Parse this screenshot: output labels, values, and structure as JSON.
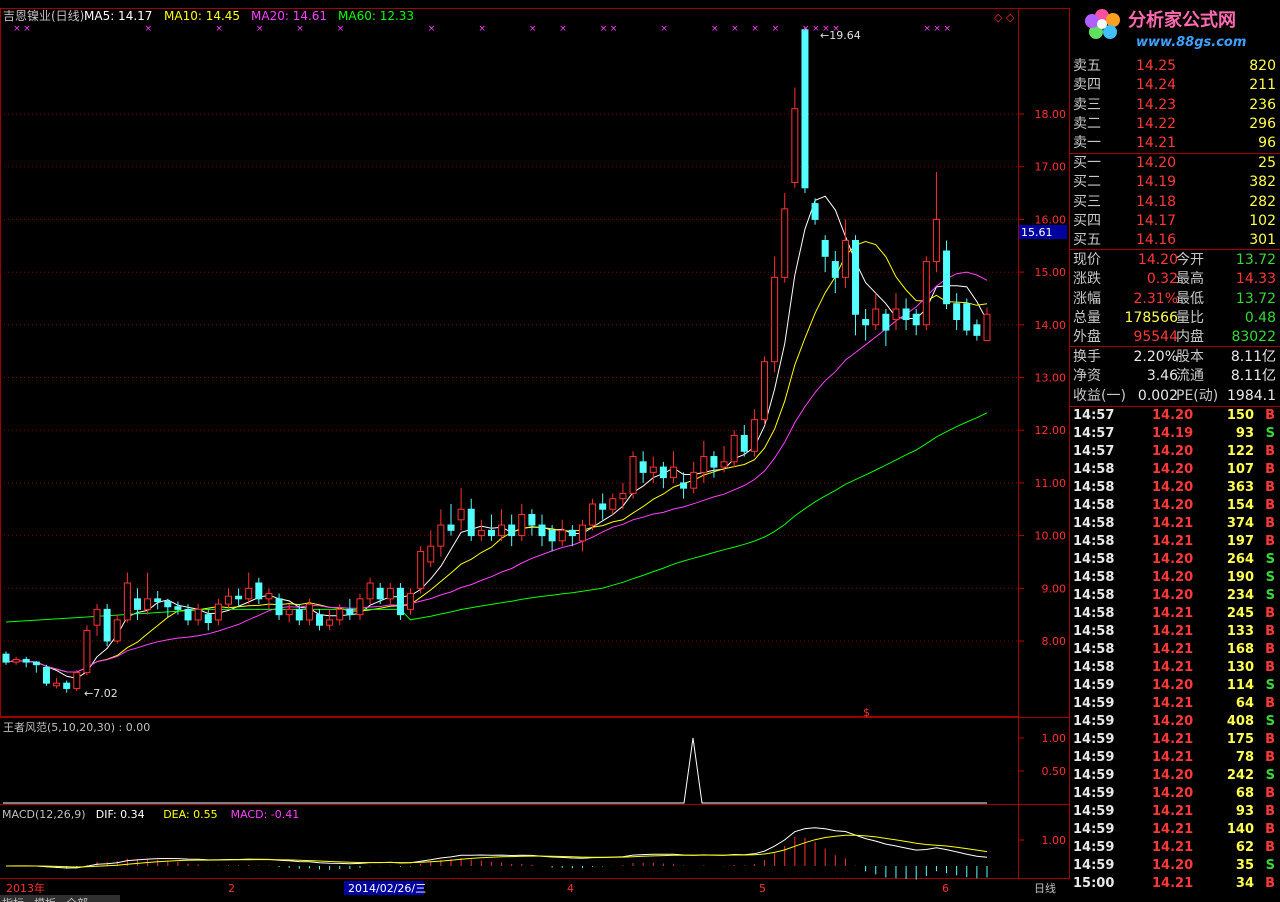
{
  "main_panel": {
    "title": "吉恩镍业(日线)",
    "ma_labels": [
      {
        "text": "MA5: 14.17",
        "color": "#ffffff"
      },
      {
        "text": "MA10: 14.45",
        "color": "#ffff00"
      },
      {
        "text": "MA20: 14.61",
        "color": "#ff40ff"
      },
      {
        "text": "MA60: 12.33",
        "color": "#00ff00"
      }
    ],
    "high_mark": "19.64",
    "low_mark": "7.02",
    "current_price_tag": "15.61",
    "y_ticks": [
      "18.00",
      "17.00",
      "16.00",
      "15.00",
      "14.00",
      "13.00",
      "12.00",
      "11.00",
      "10.00",
      "9.00",
      "8.00"
    ],
    "signal_marker": "$",
    "x_labels": [
      "2013年",
      "2",
      "2014/02/26/三",
      "4",
      "5",
      "6",
      "日线"
    ]
  },
  "indicator_panel": {
    "title": "王者风范(5,10,20,30) : 0.00",
    "y_ticks": [
      "1.00",
      "0.50"
    ]
  },
  "macd_panel": {
    "labels": [
      {
        "text": "MACD(12,26,9)",
        "color": "#c0c0c0"
      },
      {
        "text": "DIF: 0.34",
        "color": "#ffffff"
      },
      {
        "text": "DEA: 0.55",
        "color": "#ffff00"
      },
      {
        "text": "MACD: -0.41",
        "color": "#ff40ff"
      }
    ],
    "y_ticks": [
      "1.00"
    ]
  },
  "bottom_tabs": [
    "指标",
    "模板",
    "全部"
  ],
  "colors": {
    "up": "#ff3030",
    "down": "#54ffff",
    "grid": "#800000",
    "axis": "#c00000"
  },
  "logo": {
    "text": "分析家公式网",
    "url": "www.88gs.com"
  },
  "order_book": {
    "sell": [
      {
        "label": "卖五",
        "price": "14.25",
        "vol": "820"
      },
      {
        "label": "卖四",
        "price": "14.24",
        "vol": "211"
      },
      {
        "label": "卖三",
        "price": "14.23",
        "vol": "236"
      },
      {
        "label": "卖二",
        "price": "14.22",
        "vol": "296"
      },
      {
        "label": "卖一",
        "price": "14.21",
        "vol": "96"
      }
    ],
    "buy": [
      {
        "label": "买一",
        "price": "14.20",
        "vol": "25"
      },
      {
        "label": "买二",
        "price": "14.19",
        "vol": "382"
      },
      {
        "label": "买三",
        "price": "14.18",
        "vol": "282"
      },
      {
        "label": "买四",
        "price": "14.17",
        "vol": "102"
      },
      {
        "label": "买五",
        "price": "14.16",
        "vol": "301"
      }
    ]
  },
  "quote": [
    {
      "l1": "现价",
      "v1": "14.20",
      "c1": "red",
      "l2": "今开",
      "v2": "13.72",
      "c2": "grn"
    },
    {
      "l1": "涨跌",
      "v1": "0.32",
      "c1": "red",
      "l2": "最高",
      "v2": "14.33",
      "c2": "red"
    },
    {
      "l1": "涨幅",
      "v1": "2.31%",
      "c1": "red",
      "l2": "最低",
      "v2": "13.72",
      "c2": "grn"
    },
    {
      "l1": "总量",
      "v1": "178566",
      "c1": "yel",
      "l2": "量比",
      "v2": "0.48",
      "c2": "grn"
    },
    {
      "l1": "外盘",
      "v1": "95544",
      "c1": "red",
      "l2": "内盘",
      "v2": "83022",
      "c2": "grn"
    }
  ],
  "fundamentals": [
    {
      "l1": "换手",
      "v1": "2.20%",
      "l2": "股本",
      "v2": "8.11亿"
    },
    {
      "l1": "净资",
      "v1": "3.46",
      "l2": "流通",
      "v2": "8.11亿"
    },
    {
      "l1": "收益(一)",
      "v1": "0.002",
      "l2": "PE(动)",
      "v2": "1984.1"
    }
  ],
  "ticks": [
    {
      "t": "14:57",
      "p": "14.20",
      "v": "150",
      "s": "B"
    },
    {
      "t": "14:57",
      "p": "14.19",
      "v": "93",
      "s": "S"
    },
    {
      "t": "14:57",
      "p": "14.20",
      "v": "122",
      "s": "B"
    },
    {
      "t": "14:58",
      "p": "14.20",
      "v": "107",
      "s": "B"
    },
    {
      "t": "14:58",
      "p": "14.20",
      "v": "363",
      "s": "B"
    },
    {
      "t": "14:58",
      "p": "14.20",
      "v": "154",
      "s": "B"
    },
    {
      "t": "14:58",
      "p": "14.21",
      "v": "374",
      "s": "B"
    },
    {
      "t": "14:58",
      "p": "14.21",
      "v": "197",
      "s": "B"
    },
    {
      "t": "14:58",
      "p": "14.20",
      "v": "264",
      "s": "S"
    },
    {
      "t": "14:58",
      "p": "14.20",
      "v": "190",
      "s": "S"
    },
    {
      "t": "14:58",
      "p": "14.20",
      "v": "234",
      "s": "S"
    },
    {
      "t": "14:58",
      "p": "14.21",
      "v": "245",
      "s": "B"
    },
    {
      "t": "14:58",
      "p": "14.21",
      "v": "133",
      "s": "B"
    },
    {
      "t": "14:58",
      "p": "14.21",
      "v": "168",
      "s": "B"
    },
    {
      "t": "14:58",
      "p": "14.21",
      "v": "130",
      "s": "B"
    },
    {
      "t": "14:59",
      "p": "14.20",
      "v": "114",
      "s": "S"
    },
    {
      "t": "14:59",
      "p": "14.21",
      "v": "64",
      "s": "B"
    },
    {
      "t": "14:59",
      "p": "14.20",
      "v": "408",
      "s": "S"
    },
    {
      "t": "14:59",
      "p": "14.21",
      "v": "175",
      "s": "B"
    },
    {
      "t": "14:59",
      "p": "14.21",
      "v": "78",
      "s": "B"
    },
    {
      "t": "14:59",
      "p": "14.20",
      "v": "242",
      "s": "S"
    },
    {
      "t": "14:59",
      "p": "14.20",
      "v": "68",
      "s": "B"
    },
    {
      "t": "14:59",
      "p": "14.21",
      "v": "93",
      "s": "B"
    },
    {
      "t": "14:59",
      "p": "14.21",
      "v": "140",
      "s": "B"
    },
    {
      "t": "14:59",
      "p": "14.21",
      "v": "62",
      "s": "B"
    },
    {
      "t": "14:59",
      "p": "14.20",
      "v": "35",
      "s": "S"
    },
    {
      "t": "15:00",
      "p": "14.21",
      "v": "34",
      "s": "B"
    }
  ],
  "chart_data": {
    "type": "candlestick",
    "series": [
      {
        "name": "MA5",
        "last": 14.17
      },
      {
        "name": "MA10",
        "last": 14.45
      },
      {
        "name": "MA20",
        "last": 14.61
      },
      {
        "name": "MA60",
        "last": 12.33
      }
    ],
    "high": 19.64,
    "low": 7.02,
    "candles": [
      [
        7.75,
        7.6,
        7.8,
        7.55
      ],
      [
        7.6,
        7.65,
        7.7,
        7.55
      ],
      [
        7.65,
        7.6,
        7.7,
        7.5
      ],
      [
        7.6,
        7.55,
        7.62,
        7.4
      ],
      [
        7.5,
        7.2,
        7.55,
        7.15
      ],
      [
        7.15,
        7.2,
        7.3,
        7.1
      ],
      [
        7.2,
        7.1,
        7.25,
        7.02
      ],
      [
        7.1,
        7.4,
        7.45,
        7.05
      ],
      [
        7.4,
        8.2,
        8.3,
        7.35
      ],
      [
        8.3,
        8.6,
        8.7,
        8.1
      ],
      [
        8.6,
        8.0,
        8.7,
        7.9
      ],
      [
        8.0,
        8.4,
        8.5,
        7.95
      ],
      [
        8.4,
        9.1,
        9.3,
        8.35
      ],
      [
        8.8,
        8.6,
        9.0,
        8.4
      ],
      [
        8.6,
        8.8,
        9.3,
        8.5
      ],
      [
        8.8,
        8.75,
        8.95,
        8.6
      ],
      [
        8.75,
        8.65,
        8.8,
        8.45
      ],
      [
        8.65,
        8.6,
        8.75,
        8.5
      ],
      [
        8.6,
        8.4,
        8.7,
        8.3
      ],
      [
        8.4,
        8.6,
        8.7,
        8.3
      ],
      [
        8.5,
        8.35,
        8.6,
        8.2
      ],
      [
        8.4,
        8.7,
        8.8,
        8.3
      ],
      [
        8.7,
        8.85,
        9.0,
        8.6
      ],
      [
        8.85,
        8.8,
        9.0,
        8.65
      ],
      [
        8.8,
        9.0,
        9.3,
        8.7
      ],
      [
        9.1,
        8.8,
        9.2,
        8.7
      ],
      [
        8.8,
        8.9,
        9.0,
        8.6
      ],
      [
        8.8,
        8.5,
        8.9,
        8.4
      ],
      [
        8.5,
        8.6,
        8.7,
        8.35
      ],
      [
        8.6,
        8.4,
        8.7,
        8.3
      ],
      [
        8.4,
        8.7,
        8.8,
        8.3
      ],
      [
        8.5,
        8.3,
        8.6,
        8.2
      ],
      [
        8.3,
        8.4,
        8.6,
        8.2
      ],
      [
        8.4,
        8.6,
        8.7,
        8.3
      ],
      [
        8.6,
        8.5,
        8.8,
        8.4
      ],
      [
        8.5,
        8.8,
        8.9,
        8.4
      ],
      [
        8.8,
        9.1,
        9.2,
        8.7
      ],
      [
        9.0,
        8.8,
        9.1,
        8.7
      ],
      [
        8.8,
        9.0,
        9.1,
        8.7
      ],
      [
        9.0,
        8.5,
        9.1,
        8.4
      ],
      [
        8.6,
        8.9,
        9.0,
        8.5
      ],
      [
        9.0,
        9.7,
        9.8,
        8.9
      ],
      [
        9.5,
        9.8,
        10.1,
        9.4
      ],
      [
        9.8,
        10.2,
        10.5,
        9.6
      ],
      [
        10.2,
        10.1,
        10.6,
        10.0
      ],
      [
        10.3,
        10.5,
        10.9,
        10.1
      ],
      [
        10.5,
        10.0,
        10.7,
        9.9
      ],
      [
        10.0,
        10.1,
        10.3,
        9.9
      ],
      [
        10.1,
        10.0,
        10.4,
        9.9
      ],
      [
        10.0,
        10.2,
        10.5,
        9.9
      ],
      [
        10.2,
        10.0,
        10.4,
        9.8
      ],
      [
        10.0,
        10.4,
        10.6,
        9.9
      ],
      [
        10.4,
        10.2,
        10.5,
        10.0
      ],
      [
        10.2,
        10.0,
        10.4,
        9.8
      ],
      [
        10.1,
        9.9,
        10.2,
        9.7
      ],
      [
        9.9,
        10.1,
        10.3,
        9.8
      ],
      [
        10.1,
        10.0,
        10.2,
        9.8
      ],
      [
        9.9,
        10.2,
        10.3,
        9.7
      ],
      [
        10.2,
        10.6,
        10.7,
        10.1
      ],
      [
        10.6,
        10.5,
        10.8,
        10.3
      ],
      [
        10.5,
        10.7,
        10.8,
        10.4
      ],
      [
        10.7,
        10.8,
        11.0,
        10.5
      ],
      [
        10.8,
        11.5,
        11.6,
        10.7
      ],
      [
        11.4,
        11.2,
        11.6,
        11.0
      ],
      [
        11.2,
        11.3,
        11.5,
        11.0
      ],
      [
        11.3,
        11.1,
        11.4,
        10.9
      ],
      [
        11.1,
        11.3,
        11.6,
        11.0
      ],
      [
        11.0,
        10.9,
        11.2,
        10.7
      ],
      [
        10.9,
        11.2,
        11.4,
        10.8
      ],
      [
        11.2,
        11.5,
        11.8,
        11.0
      ],
      [
        11.5,
        11.3,
        11.6,
        11.1
      ],
      [
        11.3,
        11.4,
        11.7,
        11.2
      ],
      [
        11.4,
        11.9,
        12.0,
        11.3
      ],
      [
        11.9,
        11.6,
        12.1,
        11.5
      ],
      [
        11.6,
        12.2,
        12.4,
        11.5
      ],
      [
        12.2,
        13.3,
        13.4,
        12.1
      ],
      [
        13.3,
        14.9,
        15.3,
        13.1
      ],
      [
        14.9,
        16.2,
        16.5,
        14.8
      ],
      [
        16.7,
        18.1,
        18.5,
        16.6
      ],
      [
        19.6,
        16.6,
        19.64,
        16.5
      ],
      [
        16.3,
        16.0,
        16.4,
        15.9
      ],
      [
        15.6,
        15.3,
        15.7,
        15.0
      ],
      [
        15.2,
        14.9,
        15.4,
        14.6
      ],
      [
        14.9,
        15.6,
        16.0,
        14.7
      ],
      [
        15.6,
        14.2,
        15.7,
        13.8
      ],
      [
        14.1,
        14.0,
        14.3,
        13.7
      ],
      [
        14.0,
        14.3,
        14.6,
        13.9
      ],
      [
        14.2,
        13.9,
        14.3,
        13.6
      ],
      [
        14.1,
        14.3,
        14.6,
        13.9
      ],
      [
        14.3,
        14.1,
        14.5,
        13.9
      ],
      [
        14.2,
        14.0,
        14.3,
        13.8
      ],
      [
        14.0,
        15.2,
        15.3,
        13.9
      ],
      [
        15.2,
        16.0,
        16.9,
        15.0
      ],
      [
        15.4,
        14.4,
        15.6,
        14.3
      ],
      [
        14.4,
        14.1,
        14.6,
        13.9
      ],
      [
        14.4,
        13.9,
        14.5,
        13.8
      ],
      [
        14.0,
        13.8,
        14.1,
        13.7
      ],
      [
        13.7,
        14.2,
        14.33,
        13.72
      ]
    ]
  }
}
